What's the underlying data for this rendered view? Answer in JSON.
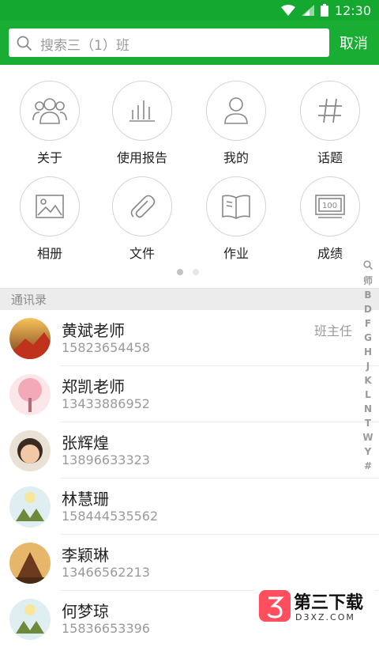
{
  "status_bar": {
    "time": "12:30"
  },
  "search": {
    "placeholder": "搜索三（1）班",
    "cancel_label": "取消"
  },
  "grid_items": [
    {
      "label": "关于",
      "icon": "group-icon"
    },
    {
      "label": "使用报告",
      "icon": "bar-chart-icon"
    },
    {
      "label": "我的",
      "icon": "person-icon"
    },
    {
      "label": "话题",
      "icon": "hashtag-icon"
    },
    {
      "label": "相册",
      "icon": "image-icon"
    },
    {
      "label": "文件",
      "icon": "paperclip-icon"
    },
    {
      "label": "作业",
      "icon": "book-icon"
    },
    {
      "label": "成绩",
      "icon": "score-icon"
    }
  ],
  "pager": {
    "pages": 2,
    "current": 1
  },
  "contacts_header": "通讯录",
  "contacts": [
    {
      "name": "黄斌老师",
      "phone": "15823654458",
      "role": "班主任"
    },
    {
      "name": "郑凯老师",
      "phone": "13433886952",
      "role": ""
    },
    {
      "name": "张辉煌",
      "phone": "13896633323",
      "role": ""
    },
    {
      "name": "林慧珊",
      "phone": "158444535562",
      "role": ""
    },
    {
      "name": "李颖琳",
      "phone": "13466562213",
      "role": ""
    },
    {
      "name": "何梦琼",
      "phone": "15836653396",
      "role": ""
    }
  ],
  "index_letters": [
    "师",
    "B",
    "D",
    "F",
    "G",
    "H",
    "J",
    "K",
    "L",
    "N",
    "T",
    "W",
    "Y",
    "#"
  ],
  "watermark": {
    "title": "第三下载",
    "subtitle": "D3XZ.COM"
  },
  "colors": {
    "brand_green": "#1aad34",
    "status_green": "#14a830"
  }
}
